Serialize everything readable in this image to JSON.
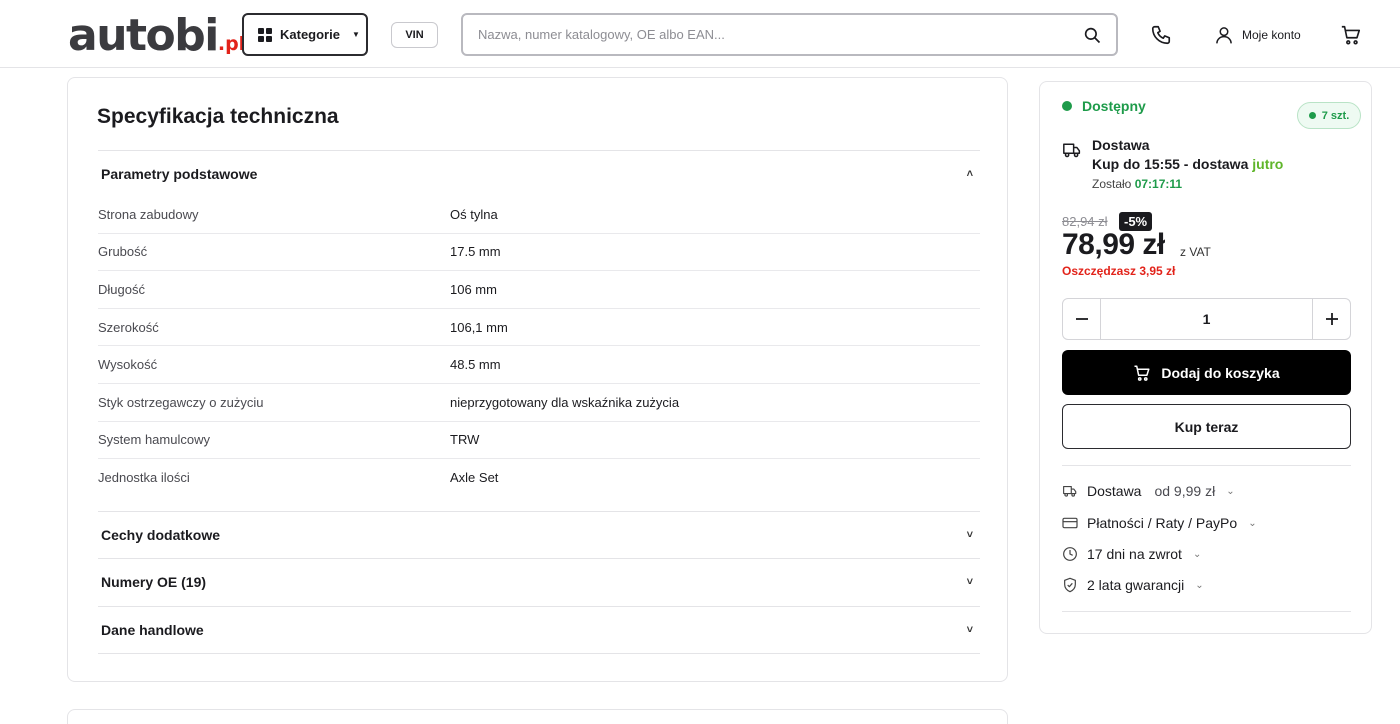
{
  "header": {
    "logo_main": "autobi",
    "logo_suffix": ".pl",
    "categories_label": "Kategorie",
    "vin_label": "VIN",
    "search_placeholder": "Nazwa, numer katalogowy, OE albo EAN...",
    "account_label": "Moje konto"
  },
  "spec": {
    "title": "Specyfikacja techniczna",
    "sections": [
      {
        "label": "Parametry podstawowe",
        "chevron": "˄"
      },
      {
        "label": "Cechy dodatkowe",
        "chevron": "˅"
      },
      {
        "label": "Numery OE (19)",
        "chevron": "˅"
      },
      {
        "label": "Dane handlowe",
        "chevron": "˅"
      }
    ],
    "rows": [
      {
        "key": "Strona zabudowy",
        "value": "Oś tylna"
      },
      {
        "key": "Grubość",
        "value": "17.5 mm"
      },
      {
        "key": "Długość",
        "value": "106 mm"
      },
      {
        "key": "Szerokość",
        "value": "106,1 mm"
      },
      {
        "key": "Wysokość",
        "value": "48.5 mm"
      },
      {
        "key": "Styk ostrzegawczy o zużyciu",
        "value": "nieprzygotowany dla wskaźnika zużycia"
      },
      {
        "key": "System hamulcowy",
        "value": "TRW"
      },
      {
        "key": "Jednostka ilości",
        "value": "Axle Set"
      }
    ]
  },
  "buy": {
    "availability": "Dostępny",
    "stock": "7 szt.",
    "delivery_title": "Dostawa",
    "delivery_line_prefix": "Kup do 15:55 - dostawa ",
    "delivery_line_day": "jutro",
    "remaining_label": "Zostało ",
    "remaining_time": "07:17:11",
    "old_price": "82,94 zł",
    "discount": "-5%",
    "price": "78,99 zł",
    "vat": "z VAT",
    "savings": "Oszczędzasz 3,95 zł",
    "quantity": "1",
    "add_to_cart": "Dodaj do koszyka",
    "buy_now": "Kup teraz",
    "info": [
      {
        "label": "Dostawa",
        "sub": "od 9,99 zł",
        "icon": "truck-icon"
      },
      {
        "label": "Płatności / Raty / PayPo",
        "sub": "",
        "icon": "card-icon"
      },
      {
        "label": "17 dni na zwrot",
        "sub": "",
        "icon": "clock-icon"
      },
      {
        "label": "2 lata gwarancji",
        "sub": "",
        "icon": "shield-icon"
      }
    ]
  },
  "colors": {
    "accent_green": "#1e9b4a",
    "delivery_green": "#5fb52a",
    "sale_red": "#e2231a",
    "primary_button": "#000000"
  }
}
